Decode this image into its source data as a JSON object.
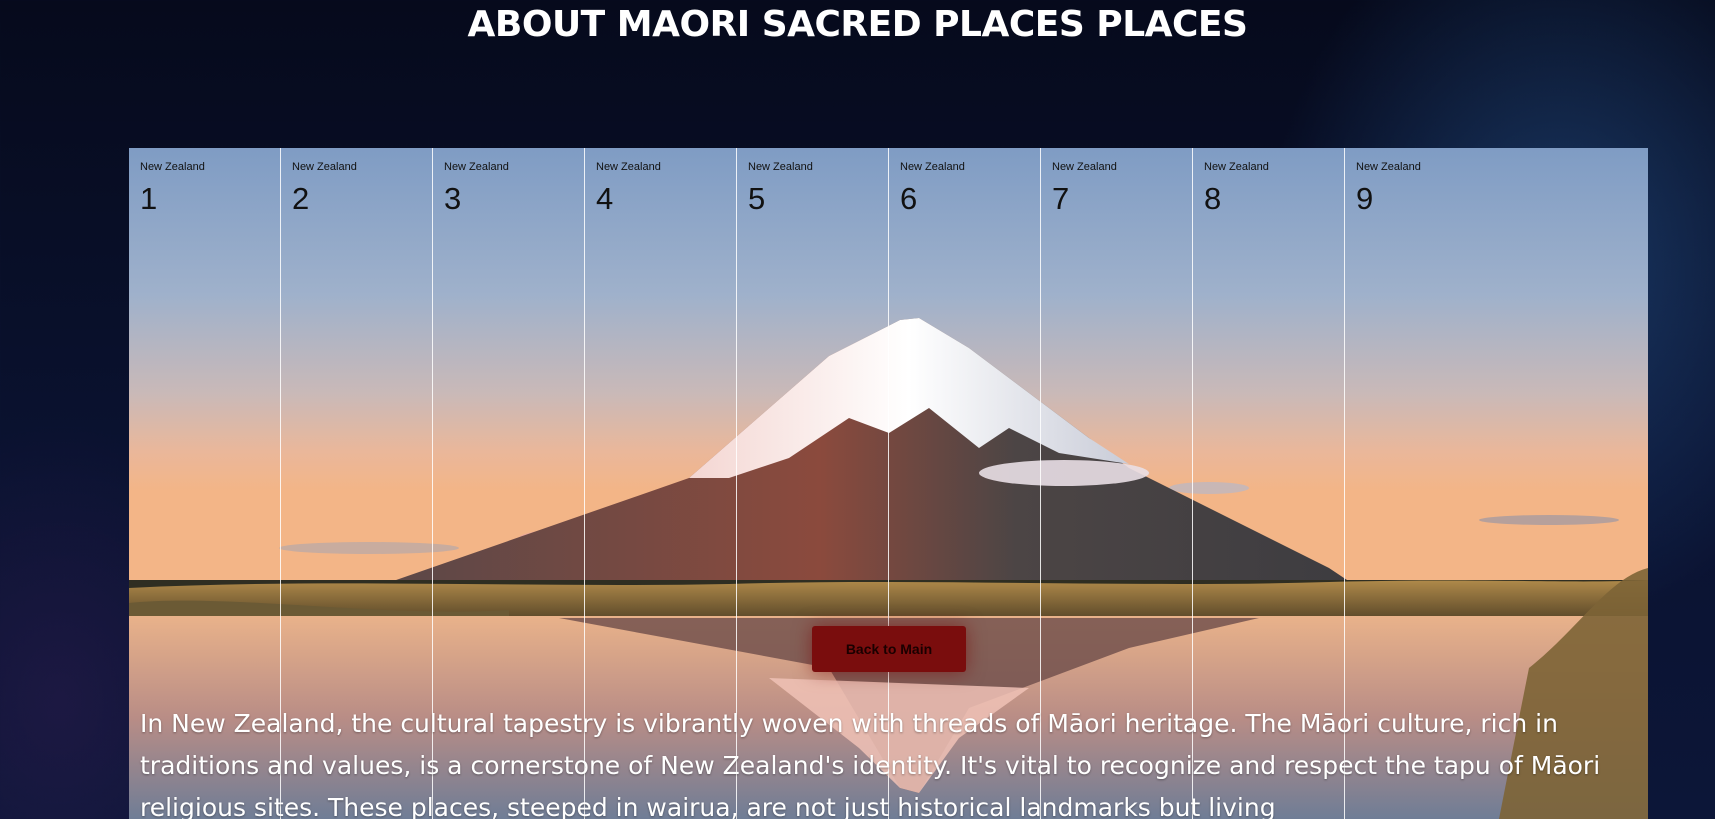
{
  "page": {
    "title": "ABOUT MAORI SACRED PLACES PLACES"
  },
  "gallery": {
    "image_subject": "mountain-lake-reflection",
    "columns": [
      {
        "country": "New Zealand",
        "number": "1"
      },
      {
        "country": "New Zealand",
        "number": "2"
      },
      {
        "country": "New Zealand",
        "number": "3"
      },
      {
        "country": "New Zealand",
        "number": "4"
      },
      {
        "country": "New Zealand",
        "number": "5"
      },
      {
        "country": "New Zealand",
        "number": "6"
      },
      {
        "country": "New Zealand",
        "number": "7"
      },
      {
        "country": "New Zealand",
        "number": "8"
      },
      {
        "country": "New Zealand",
        "number": "9"
      }
    ]
  },
  "actions": {
    "back_label": "Back to Main"
  },
  "content": {
    "intro": "In New Zealand, the cultural tapestry is vibrantly woven with threads of Māori heritage. The Māori culture, rich in traditions and values, is a cornerstone of New Zealand's identity. It's vital to recognize and respect the tapu of Māori religious sites. These places, steeped in wairua, are not just historical landmarks but living"
  },
  "colors": {
    "background": "#0a1230",
    "button": "#7a0d0d",
    "text": "#ffffff"
  }
}
